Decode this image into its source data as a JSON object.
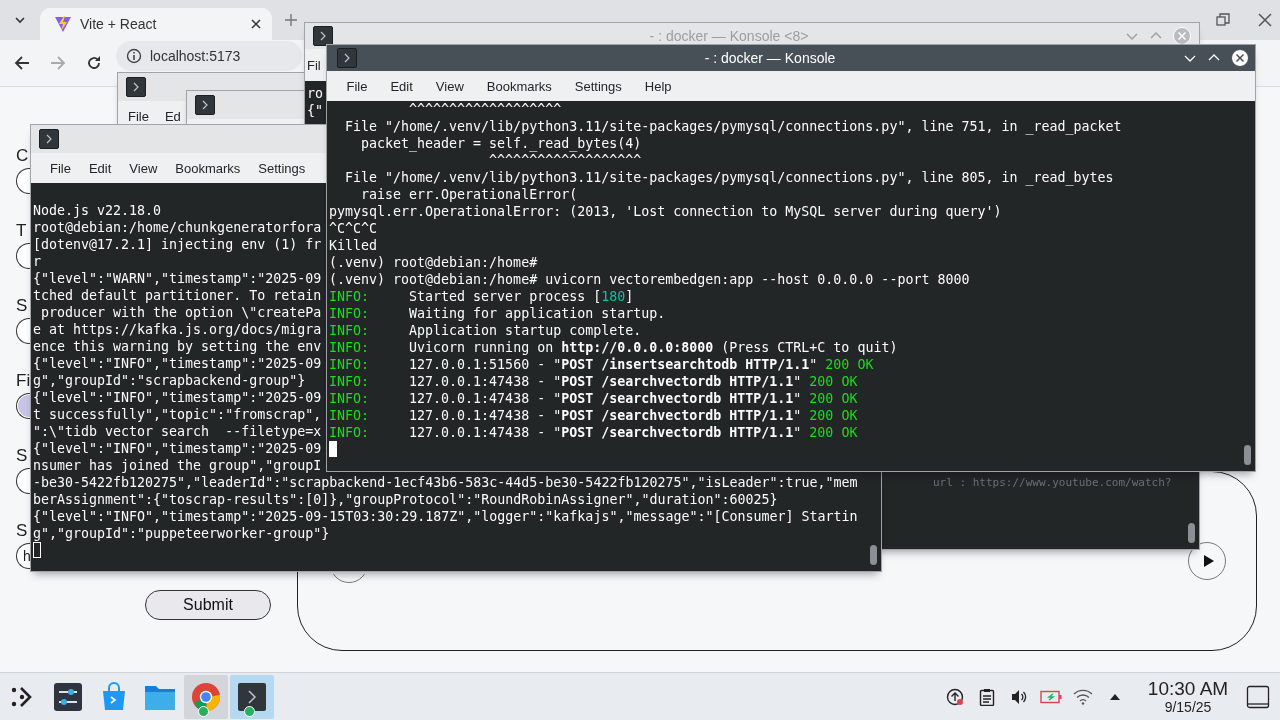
{
  "browser": {
    "tab": {
      "title": "Vite + React",
      "selected": true
    },
    "nav": [
      {
        "kind": "back",
        "disabled": false
      },
      {
        "kind": "forward",
        "disabled": true
      },
      {
        "kind": "reload",
        "disabled": false
      }
    ],
    "address": "localhost:5173",
    "form": {
      "fields": [
        {
          "label": "C",
          "kind": "text"
        },
        {
          "label": "T",
          "kind": "text"
        },
        {
          "label": "S",
          "kind": "text"
        },
        {
          "label": "Fi",
          "kind": "file"
        },
        {
          "label": "S",
          "kind": "text"
        },
        {
          "label": "S",
          "kind": "text",
          "value": "h"
        }
      ],
      "submit": "Submit"
    },
    "panel": {
      "buttons": [
        {
          "kind": "blank"
        },
        {
          "kind": "play"
        }
      ]
    }
  },
  "windows": [
    {
      "active": false,
      "menu": [
        "File",
        "Ed"
      ]
    },
    {
      "active": false
    },
    {
      "title": "- : docker — Konsole <8>",
      "active": false,
      "menu": [
        "Fil"
      ],
      "lines": [
        [
          {
            "text": "ro",
            "kind": "plain"
          }
        ],
        [
          {
            "text": "{\"",
            "kind": "plain"
          }
        ]
      ],
      "bottom_text": "url : https://www.youtube.com/watch?"
    },
    {
      "active": false,
      "cursor": true,
      "menu": [
        "File",
        "Edit",
        "View",
        "Bookmarks",
        "Settings"
      ],
      "lines": [
        [
          {
            "text": "Node.js v22.18.0",
            "kind": "plain"
          }
        ],
        [
          {
            "text": "root@debian:/home/chunkgeneratorfora",
            "kind": "plain"
          }
        ],
        [
          {
            "text": "[dotenv@17.2.1] injecting env (1) fr",
            "kind": "plain"
          }
        ],
        [
          {
            "text": "r",
            "kind": "plain"
          }
        ],
        [
          {
            "text": "{\"level\":\"WARN\",\"timestamp\":\"2025-09",
            "kind": "plain"
          }
        ],
        [
          {
            "text": "tched default partitioner. To retain",
            "kind": "plain"
          }
        ],
        [
          {
            "text": " producer with the option \\\"createPa",
            "kind": "plain"
          }
        ],
        [
          {
            "text": "e at https://kafka.js.org/docs/migra",
            "kind": "plain"
          }
        ],
        [
          {
            "text": "ence this warning by setting the env",
            "kind": "plain"
          }
        ],
        [
          {
            "text": "{\"level\":\"INFO\",\"timestamp\":\"2025-09",
            "kind": "plain"
          }
        ],
        [
          {
            "text": "g\",\"groupId\":\"scrapbackend-group\"}",
            "kind": "plain"
          }
        ],
        [
          {
            "text": "{\"level\":\"INFO\",\"timestamp\":\"2025-09",
            "kind": "plain"
          }
        ],
        [
          {
            "text": "t successfully\",\"topic\":\"fromscrap\",",
            "kind": "plain"
          }
        ],
        [
          {
            "text": "\":\\\"tidb vector search  --filetype=x",
            "kind": "plain"
          }
        ],
        [
          {
            "text": "{\"level\":\"INFO\",\"timestamp\":\"2025-09",
            "kind": "plain"
          }
        ],
        [
          {
            "text": "nsumer has joined the group\",\"groupI",
            "kind": "plain"
          }
        ],
        [
          {
            "text": "-be30-5422fb120275\",\"leaderId\":\"scrapbackend-1ecf43b6-583c-44d5-be30-5422fb120275\",\"isLeader\":true,\"mem",
            "kind": "plain"
          }
        ],
        [
          {
            "text": "berAssignment\":{\"toscrap-results\":[0]},\"groupProtocol\":\"RoundRobinAssigner\",\"duration\":60025}",
            "kind": "plain"
          }
        ],
        [
          {
            "text": "{\"level\":\"INFO\",\"timestamp\":\"2025-09-15T03:30:29.187Z\",\"logger\":\"kafkajs\",\"message\":\"[Consumer] Startin",
            "kind": "plain"
          }
        ],
        [
          {
            "text": "g\",\"groupId\":\"puppeteerworker-group\"}",
            "kind": "plain"
          }
        ]
      ]
    },
    {
      "title": "- : docker — Konsole",
      "active": true,
      "cursor": true,
      "menu": [
        "File",
        "Edit",
        "View",
        "Bookmarks",
        "Settings",
        "Help"
      ],
      "lines": [
        [
          {
            "text": "          ^^^^^^^^^^^^^^^^^^^",
            "kind": "plain"
          }
        ],
        [
          {
            "text": "  File \"/home/.venv/lib/python3.11/site-packages/pymysql/connections.py\", line 751, in _read_packet",
            "kind": "plain"
          }
        ],
        [
          {
            "text": "    packet_header = self._read_bytes(4)",
            "kind": "plain"
          }
        ],
        [
          {
            "text": "                    ^^^^^^^^^^^^^^^^^^^",
            "kind": "plain"
          }
        ],
        [
          {
            "text": "  File \"/home/.venv/lib/python3.11/site-packages/pymysql/connections.py\", line 805, in _read_bytes",
            "kind": "plain"
          }
        ],
        [
          {
            "text": "    raise err.OperationalError(",
            "kind": "plain"
          }
        ],
        [
          {
            "text": "pymysql.err.OperationalError: (2013, 'Lost connection to MySQL server during query')",
            "kind": "plain"
          }
        ],
        [
          {
            "text": "^C^C^C",
            "kind": "plain"
          }
        ],
        [
          {
            "text": "Killed",
            "kind": "plain"
          }
        ],
        [
          {
            "text": "(.venv) root@debian:/home#",
            "kind": "plain"
          }
        ],
        [
          {
            "text": "(.venv) root@debian:/home# uvicorn vectorembedgen:app --host 0.0.0.0 --port 8000",
            "kind": "plain"
          }
        ],
        [
          {
            "text": "INFO:",
            "kind": "green"
          },
          {
            "text": "     Started server process [",
            "kind": "plain"
          },
          {
            "text": "180",
            "kind": "teal"
          },
          {
            "text": "]",
            "kind": "plain"
          }
        ],
        [
          {
            "text": "INFO:",
            "kind": "green"
          },
          {
            "text": "     Waiting for application startup.",
            "kind": "plain"
          }
        ],
        [
          {
            "text": "INFO:",
            "kind": "green"
          },
          {
            "text": "     Application startup complete.",
            "kind": "plain"
          }
        ],
        [
          {
            "text": "INFO:",
            "kind": "green"
          },
          {
            "text": "     Uvicorn running on ",
            "kind": "plain"
          },
          {
            "text": "http://0.0.0.0:8000",
            "kind": "bold"
          },
          {
            "text": " (Press CTRL+C to quit)",
            "kind": "plain"
          }
        ],
        [
          {
            "text": "INFO:",
            "kind": "green"
          },
          {
            "text": "     127.0.0.1:51560 - \"",
            "kind": "plain"
          },
          {
            "text": "POST /insertsearchtodb HTTP/1.1",
            "kind": "bold"
          },
          {
            "text": "\" ",
            "kind": "plain"
          },
          {
            "text": "200 OK",
            "kind": "green"
          }
        ],
        [
          {
            "text": "INFO:",
            "kind": "green"
          },
          {
            "text": "     127.0.0.1:47438 - \"",
            "kind": "plain"
          },
          {
            "text": "POST /searchvectordb HTTP/1.1",
            "kind": "bold"
          },
          {
            "text": "\" ",
            "kind": "plain"
          },
          {
            "text": "200 OK",
            "kind": "green"
          }
        ],
        [
          {
            "text": "INFO:",
            "kind": "green"
          },
          {
            "text": "     127.0.0.1:47438 - \"",
            "kind": "plain"
          },
          {
            "text": "POST /searchvectordb HTTP/1.1",
            "kind": "bold"
          },
          {
            "text": "\" ",
            "kind": "plain"
          },
          {
            "text": "200 OK",
            "kind": "green"
          }
        ],
        [
          {
            "text": "INFO:",
            "kind": "green"
          },
          {
            "text": "     127.0.0.1:47438 - \"",
            "kind": "plain"
          },
          {
            "text": "POST /searchvectordb HTTP/1.1",
            "kind": "bold"
          },
          {
            "text": "\" ",
            "kind": "plain"
          },
          {
            "text": "200 OK",
            "kind": "green"
          }
        ],
        [
          {
            "text": "INFO:",
            "kind": "green"
          },
          {
            "text": "     127.0.0.1:47438 - \"",
            "kind": "plain"
          },
          {
            "text": "POST /searchvectordb HTTP/1.1",
            "kind": "bold"
          },
          {
            "text": "\" ",
            "kind": "plain"
          },
          {
            "text": "200 OK",
            "kind": "green"
          }
        ]
      ]
    }
  ],
  "taskbar": {
    "apps": [
      {
        "kind": "launcher",
        "running": false,
        "selected": false
      },
      {
        "kind": "settings",
        "running": false,
        "selected": false
      },
      {
        "kind": "store",
        "running": false,
        "selected": false
      },
      {
        "kind": "files",
        "running": false,
        "selected": false
      },
      {
        "kind": "browser",
        "running": true,
        "selected": false
      },
      {
        "kind": "terminal",
        "running": true,
        "selected": true
      }
    ],
    "tray": [
      {
        "kind": "updates"
      },
      {
        "kind": "clipboard"
      },
      {
        "kind": "volume"
      },
      {
        "kind": "battery"
      },
      {
        "kind": "network"
      },
      {
        "kind": "expand"
      }
    ],
    "clock": {
      "time": "10:30 AM",
      "date": "9/15/25"
    }
  }
}
